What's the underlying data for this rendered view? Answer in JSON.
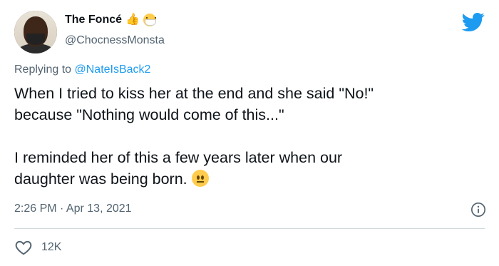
{
  "author": {
    "display_name": "The Foncé",
    "handle": "@ChocnessMonsta",
    "name_emojis": [
      "thumbs-up-dark-skin",
      "face-with-medical-mask"
    ]
  },
  "reply": {
    "prefix": "Replying to ",
    "to_handle": "@NateIsBack2"
  },
  "tweet": {
    "paragraph_1_line_1": "When I tried to kiss her at the end and she said \"No!\"",
    "paragraph_1_line_2": "because \"Nothing would come of this...\"",
    "paragraph_2_line_1": "I reminded her of this a few years later when our",
    "paragraph_2_line_2": "daughter was being born.",
    "trailing_emoji": "neutral-face"
  },
  "meta": {
    "timestamp": "2:26 PM · Apr 13, 2021"
  },
  "actions": {
    "like_count": "12K"
  },
  "icons": {
    "brand": "twitter-bird-icon",
    "info": "info-icon",
    "like": "heart-icon"
  },
  "colors": {
    "twitter_blue": "#1d9bf0",
    "text_primary": "#0f1419",
    "text_secondary": "#536471",
    "divider": "#cfd9de"
  }
}
